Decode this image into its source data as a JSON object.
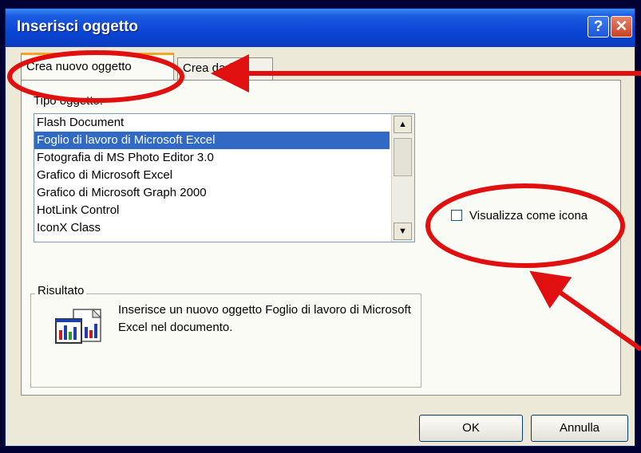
{
  "window": {
    "title": "Inserisci oggetto",
    "help_button": "?",
    "close_button": "✕"
  },
  "tabs": [
    {
      "label": "Crea nuovo oggetto",
      "active": true
    },
    {
      "label": "Crea da file",
      "active": false
    }
  ],
  "object_type": {
    "label": "Tipo oggetto:",
    "items": [
      {
        "label": "Flash Document",
        "selected": false
      },
      {
        "label": "Foglio di lavoro di Microsoft Excel",
        "selected": true
      },
      {
        "label": "Fotografia di MS Photo Editor 3.0",
        "selected": false
      },
      {
        "label": "Grafico di Microsoft Excel",
        "selected": false
      },
      {
        "label": "Grafico di Microsoft Graph 2000",
        "selected": false
      },
      {
        "label": "HotLink Control",
        "selected": false
      },
      {
        "label": "IconX Class",
        "selected": false
      }
    ]
  },
  "display_as_icon": {
    "label": "Visualizza come icona",
    "checked": false
  },
  "result": {
    "title": "Risultato",
    "text": "Inserisce un nuovo oggetto Foglio di lavoro di Microsoft Excel nel documento.",
    "icon": "excel-object-icon"
  },
  "buttons": {
    "ok": "OK",
    "cancel": "Annulla"
  },
  "annotation_color": "#e01010"
}
